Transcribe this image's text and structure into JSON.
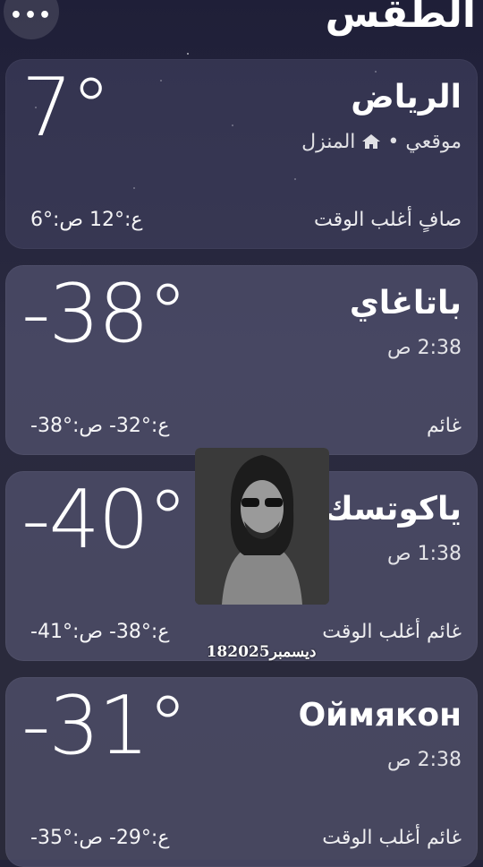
{
  "header": {
    "title": "الطقس",
    "more_label": "•••"
  },
  "locations": [
    {
      "city": "الرياض",
      "subtitle_prefix": "موقعي •",
      "subtitle_home": "المنزل",
      "temp": "7°",
      "condition": "صافٍ أغلب الوقت",
      "hilo": "ع:°12  ص:°6"
    },
    {
      "city": "باتاغاي",
      "subtitle": "2:38 ص",
      "temp": "-38°",
      "condition": "غائم",
      "hilo": "ع:°32-  ص:°38-"
    },
    {
      "city": "ياكوتسك",
      "subtitle": "1:38 ص",
      "temp": "-40°",
      "condition": "غائم أغلب الوقت",
      "hilo": "ع:°38-  ص:°41-"
    },
    {
      "city": "Оймякон",
      "subtitle": "2:38 ص",
      "temp": "-31°",
      "condition": "غائم أغلب الوقت",
      "hilo": "ع:°29-  ص:°35-"
    }
  ],
  "overlay": {
    "caption": "18ديسمبر2025"
  },
  "colors": {
    "background": "#23233a",
    "card": "#46466a"
  },
  "icons": {
    "home": "home-icon",
    "more": "more-icon"
  }
}
